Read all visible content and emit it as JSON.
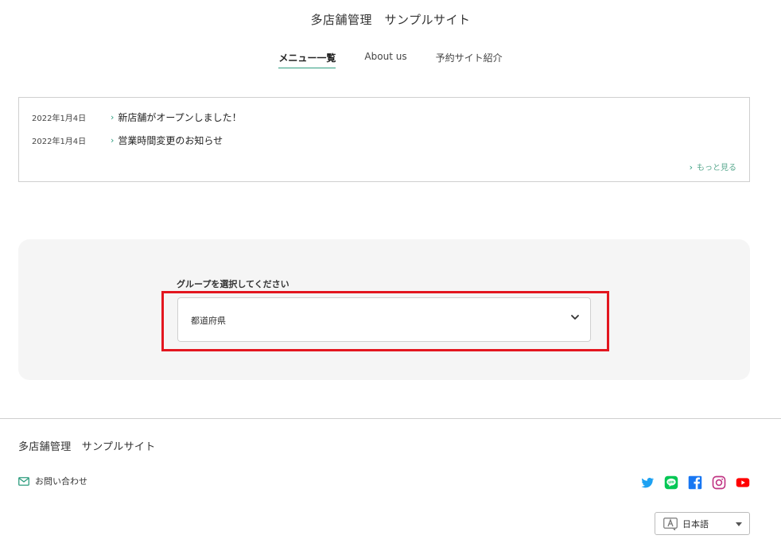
{
  "header": {
    "site_title": "多店舗管理　サンプルサイト"
  },
  "nav": [
    {
      "label": "メニュー一覧",
      "active": true
    },
    {
      "label": "About us",
      "active": false
    },
    {
      "label": "予約サイト紹介",
      "active": false
    }
  ],
  "news": {
    "items": [
      {
        "date": "2022年1月4日",
        "title": "新店舗がオープンしました！"
      },
      {
        "date": "2022年1月4日",
        "title": "営業時間変更のお知らせ"
      }
    ],
    "more_label": "もっと見る"
  },
  "group_select": {
    "label": "グループを選択してください",
    "selected": "都道府県"
  },
  "footer": {
    "site_title": "多店舗管理　サンプルサイト",
    "contact_label": "お問い合わせ",
    "social": [
      "twitter-icon",
      "line-icon",
      "facebook-icon",
      "instagram-icon",
      "youtube-icon"
    ],
    "language": "日本語"
  },
  "colors": {
    "accent": "#2e9d7f",
    "highlight": "#e3161f",
    "panel_bg": "#f5f5f5"
  }
}
